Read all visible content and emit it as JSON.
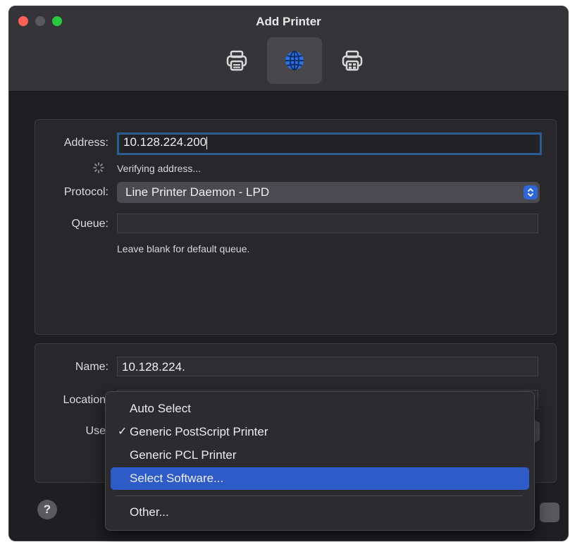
{
  "window": {
    "title": "Add Printer"
  },
  "toolbar": {
    "tabs": [
      {
        "name": "default",
        "icon": "printer-icon"
      },
      {
        "name": "ip",
        "icon": "globe-icon",
        "active": true
      },
      {
        "name": "windows",
        "icon": "printer-icon"
      }
    ]
  },
  "address": {
    "label": "Address:",
    "value": "10.128.224.200",
    "status": "Verifying address..."
  },
  "protocol": {
    "label": "Protocol:",
    "value": "Line Printer Daemon - LPD"
  },
  "queue": {
    "label": "Queue:",
    "value": "",
    "hint": "Leave blank for default queue."
  },
  "name": {
    "label": "Name:",
    "value": "10.128.224."
  },
  "location": {
    "label": "Location"
  },
  "use": {
    "label": "Use"
  },
  "use_menu": {
    "items": [
      {
        "label": "Auto Select",
        "checked": false,
        "highlighted": false
      },
      {
        "label": "Generic PostScript Printer",
        "checked": true,
        "highlighted": false
      },
      {
        "label": "Generic PCL Printer",
        "checked": false,
        "highlighted": false
      },
      {
        "label": "Select Software...",
        "checked": false,
        "highlighted": true
      },
      {
        "label": "Other...",
        "checked": false,
        "highlighted": false
      }
    ],
    "check_glyph": "✓"
  },
  "help": {
    "label": "?"
  },
  "colors": {
    "accent": "#2e5bc6",
    "focus_ring": "#2a5c93",
    "close": "#fe5f57",
    "maximize": "#28c840"
  }
}
